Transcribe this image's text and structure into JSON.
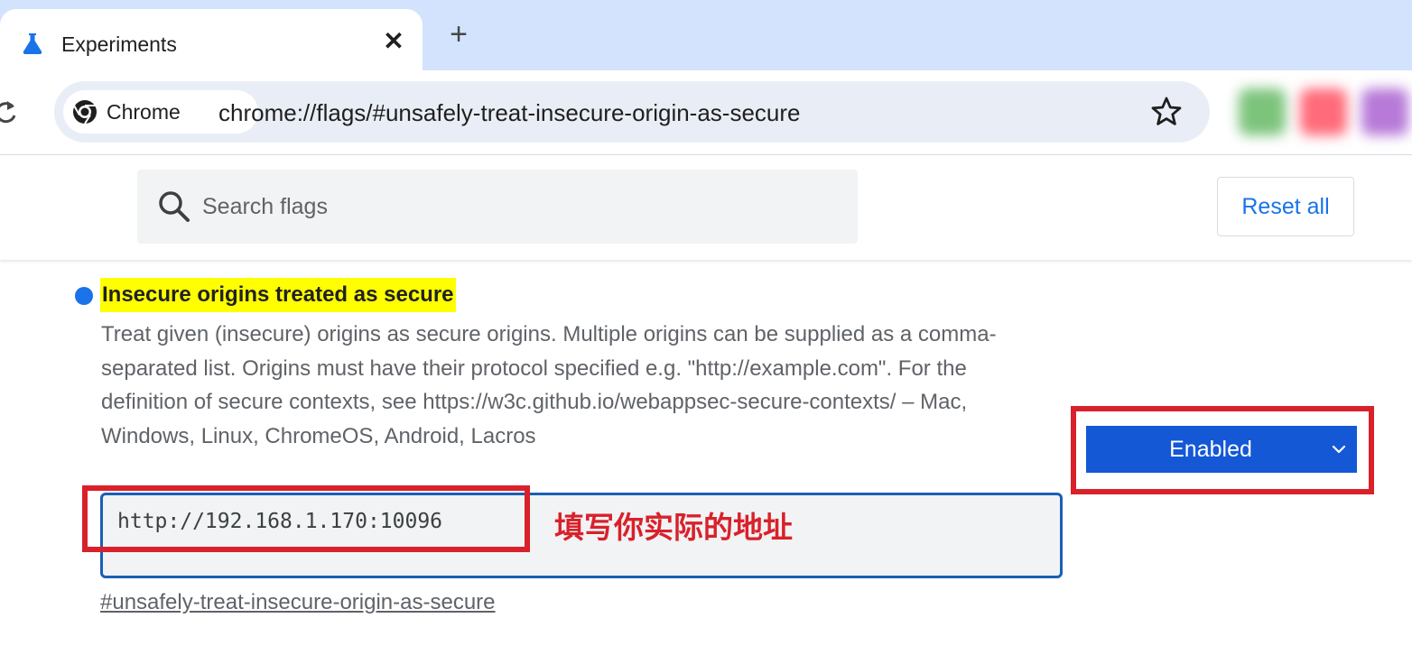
{
  "browser": {
    "tab": {
      "title": "Experiments",
      "close_glyph": "✕",
      "icon": "flask-icon"
    },
    "new_tab_glyph": "+",
    "omnibox": {
      "chip_label": "Chrome",
      "url": "chrome://flags/#unsafely-treat-insecure-origin-as-secure"
    },
    "extensions": [
      {
        "icon": "extension-icon",
        "color": "#7cc47c"
      },
      {
        "icon": "extension-icon",
        "color": "#ff6b7a"
      },
      {
        "icon": "extension-icon",
        "color": "#b77ad8"
      }
    ]
  },
  "flags_page": {
    "search": {
      "placeholder": "Search flags",
      "value": ""
    },
    "reset_button": "Reset all",
    "flag": {
      "title": "Insecure origins treated as secure",
      "description": "Treat given (insecure) origins as secure origins. Multiple origins can be supplied as a comma-separated list. Origins must have their protocol specified e.g. \"http://example.com\". For the definition of secure contexts, see https://w3c.github.io/webappsec-secure-contexts/ – Mac, Windows, Linux, ChromeOS, Android, Lacros",
      "origins_value": "http://192.168.1.170:10096",
      "state": "Enabled",
      "link": "#unsafely-treat-insecure-origin-as-secure"
    }
  },
  "annotation": {
    "note": "填写你实际的地址",
    "color": "#d9212b"
  },
  "colors": {
    "accent": "#1a73e8",
    "select_bg": "#1558d6",
    "highlight": "#ffff00",
    "tabstrip": "#d3e3fd"
  }
}
